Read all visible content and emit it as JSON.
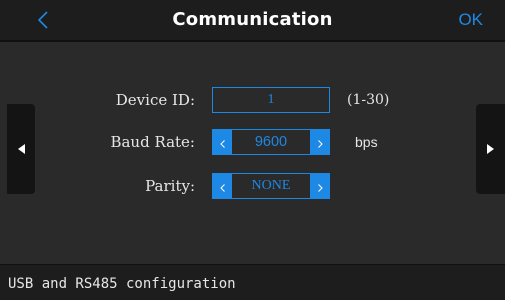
{
  "header": {
    "back_icon": "chevron-left-icon",
    "title": "Communication",
    "ok_label": "OK",
    "accent_color": "#1e88e5"
  },
  "nav": {
    "prev_icon": "triangle-left-icon",
    "next_icon": "triangle-right-icon"
  },
  "settings": {
    "device_id": {
      "label": "Device ID:",
      "value": "1",
      "range": "(1-30)"
    },
    "baud_rate": {
      "label": "Baud Rate:",
      "value": "9600",
      "unit": "bps",
      "decrement_icon": "chevron-left-icon",
      "increment_icon": "chevron-right-icon"
    },
    "parity": {
      "label": "Parity:",
      "value": "NONE",
      "decrement_icon": "chevron-left-icon",
      "increment_icon": "chevron-right-icon"
    }
  },
  "status": {
    "text": "USB and RS485 configuration"
  }
}
